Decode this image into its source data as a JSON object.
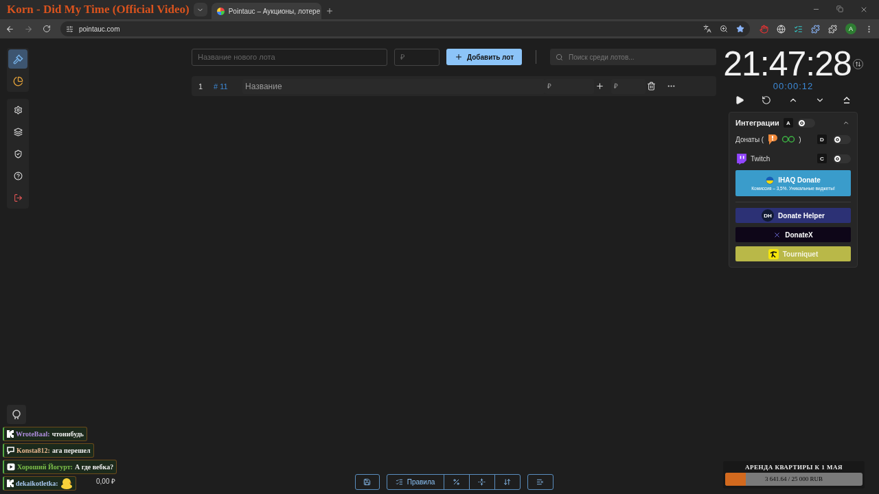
{
  "browser": {
    "tab_title": "Pointauc – Аукционы, лотере",
    "url": "pointauc.com",
    "profile_initial": "A"
  },
  "now_playing": "Korn - Did My Time (Official Video)",
  "sidebar": {
    "items": [
      {
        "kind": "gavel",
        "selected": true
      },
      {
        "kind": "pie",
        "selected": false
      },
      {
        "kind": "settings",
        "selected": false
      },
      {
        "kind": "layers",
        "selected": false
      },
      {
        "kind": "shield",
        "selected": false
      },
      {
        "kind": "help",
        "selected": false
      },
      {
        "kind": "logout",
        "selected": false
      }
    ]
  },
  "new_lot": {
    "name_placeholder": "Название нового лота",
    "amount_placeholder": "₽",
    "add_button": "Добавить лот"
  },
  "search": {
    "placeholder": "Поиск среди лотов..."
  },
  "lots": [
    {
      "index": "1",
      "id": "# 11",
      "name_placeholder": "Название",
      "amount_placeholder": "₽",
      "add_placeholder": "₽"
    }
  ],
  "timer": {
    "clock": "21:47:28",
    "elapsed": "00:00:12"
  },
  "integrations": {
    "title": "Интеграции",
    "hotkey": "A",
    "on": false,
    "expanded": true,
    "rows": [
      {
        "kind": "donations",
        "label": "Донаты (",
        "label_end": ")",
        "hotkey": "D",
        "on": false
      },
      {
        "kind": "twitch",
        "label": "Twitch",
        "hotkey": "C",
        "on": false
      }
    ],
    "services": [
      {
        "kind": "ihaq",
        "name": "IHAQ Donate",
        "subtitle": "Комиссия – 3,5%. Уникальные виджеты!"
      },
      {
        "kind": "donate-helper",
        "name": "Donate Helper",
        "logo_text": "DH"
      },
      {
        "kind": "donatex",
        "name": "DonateX"
      },
      {
        "kind": "tourniquet",
        "name": "Tourniquet"
      }
    ]
  },
  "toolbar": {
    "rules": "Правила"
  },
  "chat": [
    {
      "kind": "kick",
      "user": "WroteBaal:",
      "color": "#b08ee0",
      "text": "чтонибудь"
    },
    {
      "kind": "twitch",
      "user": "Konsta812:",
      "color": "#e8b890",
      "text": "ага перешел"
    },
    {
      "kind": "youtube",
      "user": "Хороший Йогурт:",
      "color": "#7cc04a",
      "text": "А где вебка?"
    },
    {
      "kind": "kick",
      "user": "dekaikotletka:",
      "color": "#a8c8f0",
      "emote": true
    }
  ],
  "total": "0,00 ₽",
  "goal": {
    "title": "АРЕНДА КВАРТИРЫ К 1 МАЯ",
    "progress": "3 641.64 / 25 000 RUB",
    "level": 0.15
  }
}
